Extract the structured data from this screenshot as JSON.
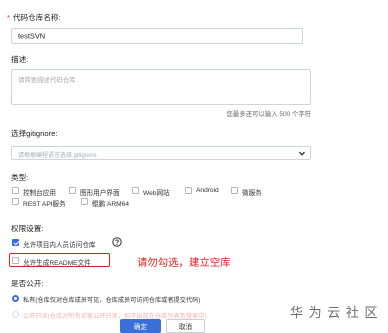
{
  "repo_name": {
    "label": "代码仓库名称:",
    "required_mark": "*",
    "value": "testSVN"
  },
  "description": {
    "label": "描述:",
    "placeholder": "请简要描述代码仓库",
    "hint": "您最多还可以输入 500 个字符"
  },
  "gitignore": {
    "label": "选择gitignore:",
    "placeholder": "请根据编程语言选择.gitignore"
  },
  "type": {
    "label": "类型:",
    "options": [
      "控制台应用",
      "图形用户界面",
      "Web网站",
      "Android",
      "微服务",
      "REST API服务",
      "鲲鹏 ARM64"
    ]
  },
  "permission": {
    "label": "权限设置:",
    "allow_members": "允许项目内人员访问仓库",
    "generate_readme": "允许生成README文件",
    "annotation": "请勿勾选，建立空库",
    "highlight_color": "#e02020"
  },
  "visibility": {
    "label": "是否公开:",
    "private": "私有(仓库仅对仓库成员可见，仓库成员可访问仓库或者提交代码)",
    "public": "公开只读(仓库对所有访客公开只读，但不出现在仓库列表及搜索中)"
  },
  "actions": {
    "confirm": "确定",
    "cancel": "取消",
    "accent": "#3a6fd8"
  },
  "watermark": "华 为 云 社 区"
}
